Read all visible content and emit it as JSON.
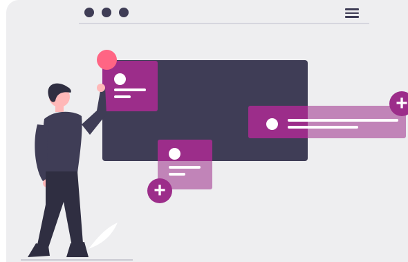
{
  "illustration": {
    "window_dots": [
      "dot",
      "dot",
      "dot"
    ],
    "menu_icon": "hamburger-menu-icon",
    "notes": [
      {
        "name": "note-card-1",
        "color": "#9c2d8a"
      },
      {
        "name": "note-card-2",
        "color": "#9c2d8a"
      },
      {
        "name": "note-card-3",
        "color": "#9c2d8a"
      }
    ],
    "add_buttons": [
      {
        "name": "add-note-button-1",
        "icon": "plus-icon",
        "glyph": "+"
      },
      {
        "name": "add-note-button-2",
        "icon": "plus-icon",
        "glyph": "+"
      }
    ],
    "colors": {
      "accent": "#9c2d8a",
      "dark": "#3f3d56",
      "pin": "#ff6584",
      "background": "#eeeef0"
    }
  }
}
